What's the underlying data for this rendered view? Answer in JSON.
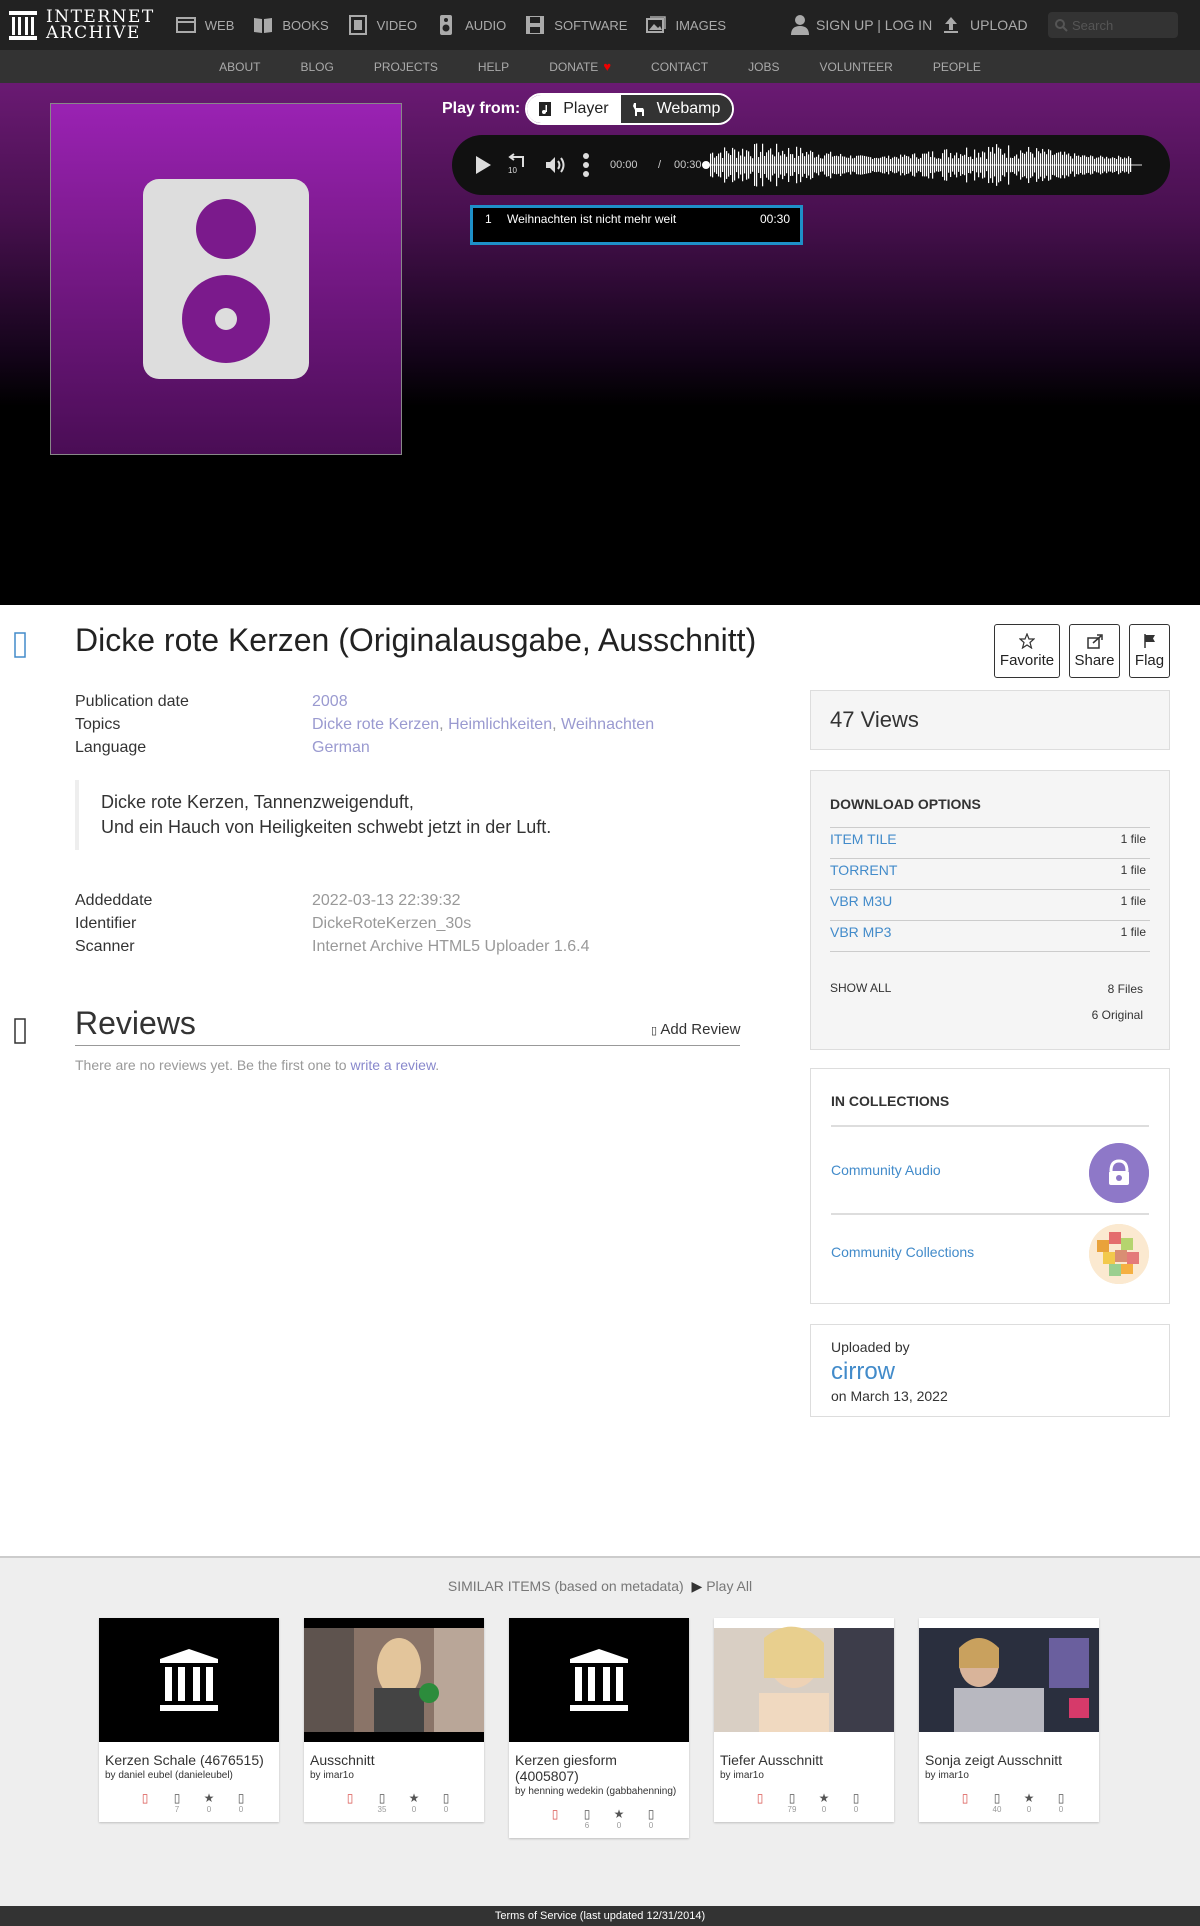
{
  "logo": {
    "line1": "INTERNET",
    "line2": "ARCHIVE"
  },
  "media_nav": [
    {
      "label": "WEB",
      "icon": "web-icon"
    },
    {
      "label": "BOOKS",
      "icon": "books-icon"
    },
    {
      "label": "VIDEO",
      "icon": "video-icon"
    },
    {
      "label": "AUDIO",
      "icon": "audio-icon"
    },
    {
      "label": "SOFTWARE",
      "icon": "software-icon"
    },
    {
      "label": "IMAGES",
      "icon": "images-icon"
    }
  ],
  "user": {
    "signup_login": "SIGN UP | LOG IN",
    "upload": "UPLOAD",
    "search_placeholder": "Search"
  },
  "subnav": [
    "ABOUT",
    "BLOG",
    "PROJECTS",
    "HELP",
    "DONATE",
    "CONTACT",
    "JOBS",
    "VOLUNTEER",
    "PEOPLE"
  ],
  "player": {
    "play_from_label": "Play from:",
    "player_label": "Player",
    "webamp_label": "Webamp",
    "current_time": "00:00",
    "separator": "/",
    "total_time": "00:30",
    "track": {
      "number": "1",
      "title": "Weihnachten ist nicht mehr weit",
      "duration": "00:30"
    }
  },
  "item": {
    "title": "Dicke rote Kerzen (Originalausgabe, Ausschnitt)",
    "actions": {
      "favorite": "Favorite",
      "share": "Share",
      "flag": "Flag"
    },
    "metadata": {
      "publication_date_label": "Publication date",
      "publication_date": "2008",
      "topics_label": "Topics",
      "topics": [
        "Dicke rote Kerzen",
        "Heimlichkeiten",
        "Weihnachten"
      ],
      "language_label": "Language",
      "language": "German"
    },
    "description": {
      "line1": "Dicke rote Kerzen, Tannenzweigenduft,",
      "line2": "Und ein Hauch von Heiligkeiten schwebt jetzt in der Luft."
    },
    "extra_metadata": {
      "addeddate_label": "Addeddate",
      "addeddate": "2022-03-13 22:39:32",
      "identifier_label": "Identifier",
      "identifier": "DickeRoteKerzen_30s",
      "scanner_label": "Scanner",
      "scanner": "Internet Archive HTML5 Uploader 1.6.4"
    }
  },
  "reviews": {
    "title": "Reviews",
    "add_review": "Add Review",
    "empty_text": "There are no reviews yet. Be the first one to",
    "empty_link": "write a review",
    "empty_end": "."
  },
  "sidebar": {
    "views": "47 Views",
    "download_title": "DOWNLOAD OPTIONS",
    "downloads": [
      {
        "label": "ITEM TILE",
        "count": "1 file"
      },
      {
        "label": "TORRENT",
        "count": "1 file"
      },
      {
        "label": "VBR M3U",
        "count": "1 file"
      },
      {
        "label": "VBR MP3",
        "count": "1 file"
      }
    ],
    "show_all": "SHOW ALL",
    "files_total": "8 Files",
    "files_original": "6 Original",
    "collections_title": "IN COLLECTIONS",
    "collections": [
      "Community Audio",
      "Community Collections"
    ],
    "uploaded_by_label": "Uploaded by",
    "uploader": "cirrow",
    "upload_date": "on March 13, 2022"
  },
  "similar": {
    "heading": "SIMILAR ITEMS (based on metadata)",
    "play_all": "Play All",
    "items": [
      {
        "title": "Kerzen Schale (4676515)",
        "by": "by daniel eubel (danieleubel)",
        "views": "7",
        "favs": "0",
        "reviews": "0"
      },
      {
        "title": "Ausschnitt",
        "by": "by imar1o",
        "views": "35",
        "favs": "0",
        "reviews": "0"
      },
      {
        "title": "Kerzen giesform (4005807)",
        "by": "by henning wedekin (gabbahenning)",
        "views": "6",
        "favs": "0",
        "reviews": "0"
      },
      {
        "title": "Tiefer Ausschnitt",
        "by": "by imar1o",
        "views": "79",
        "favs": "0",
        "reviews": "0"
      },
      {
        "title": "Sonja zeigt Ausschnitt",
        "by": "by imar1o",
        "views": "40",
        "favs": "0",
        "reviews": "0"
      }
    ]
  },
  "footer": "Terms of Service (last updated 12/31/2014)",
  "colors": {
    "link": "#428bca",
    "hero_purple": "#6a1a73",
    "nav_bg": "#222222"
  }
}
